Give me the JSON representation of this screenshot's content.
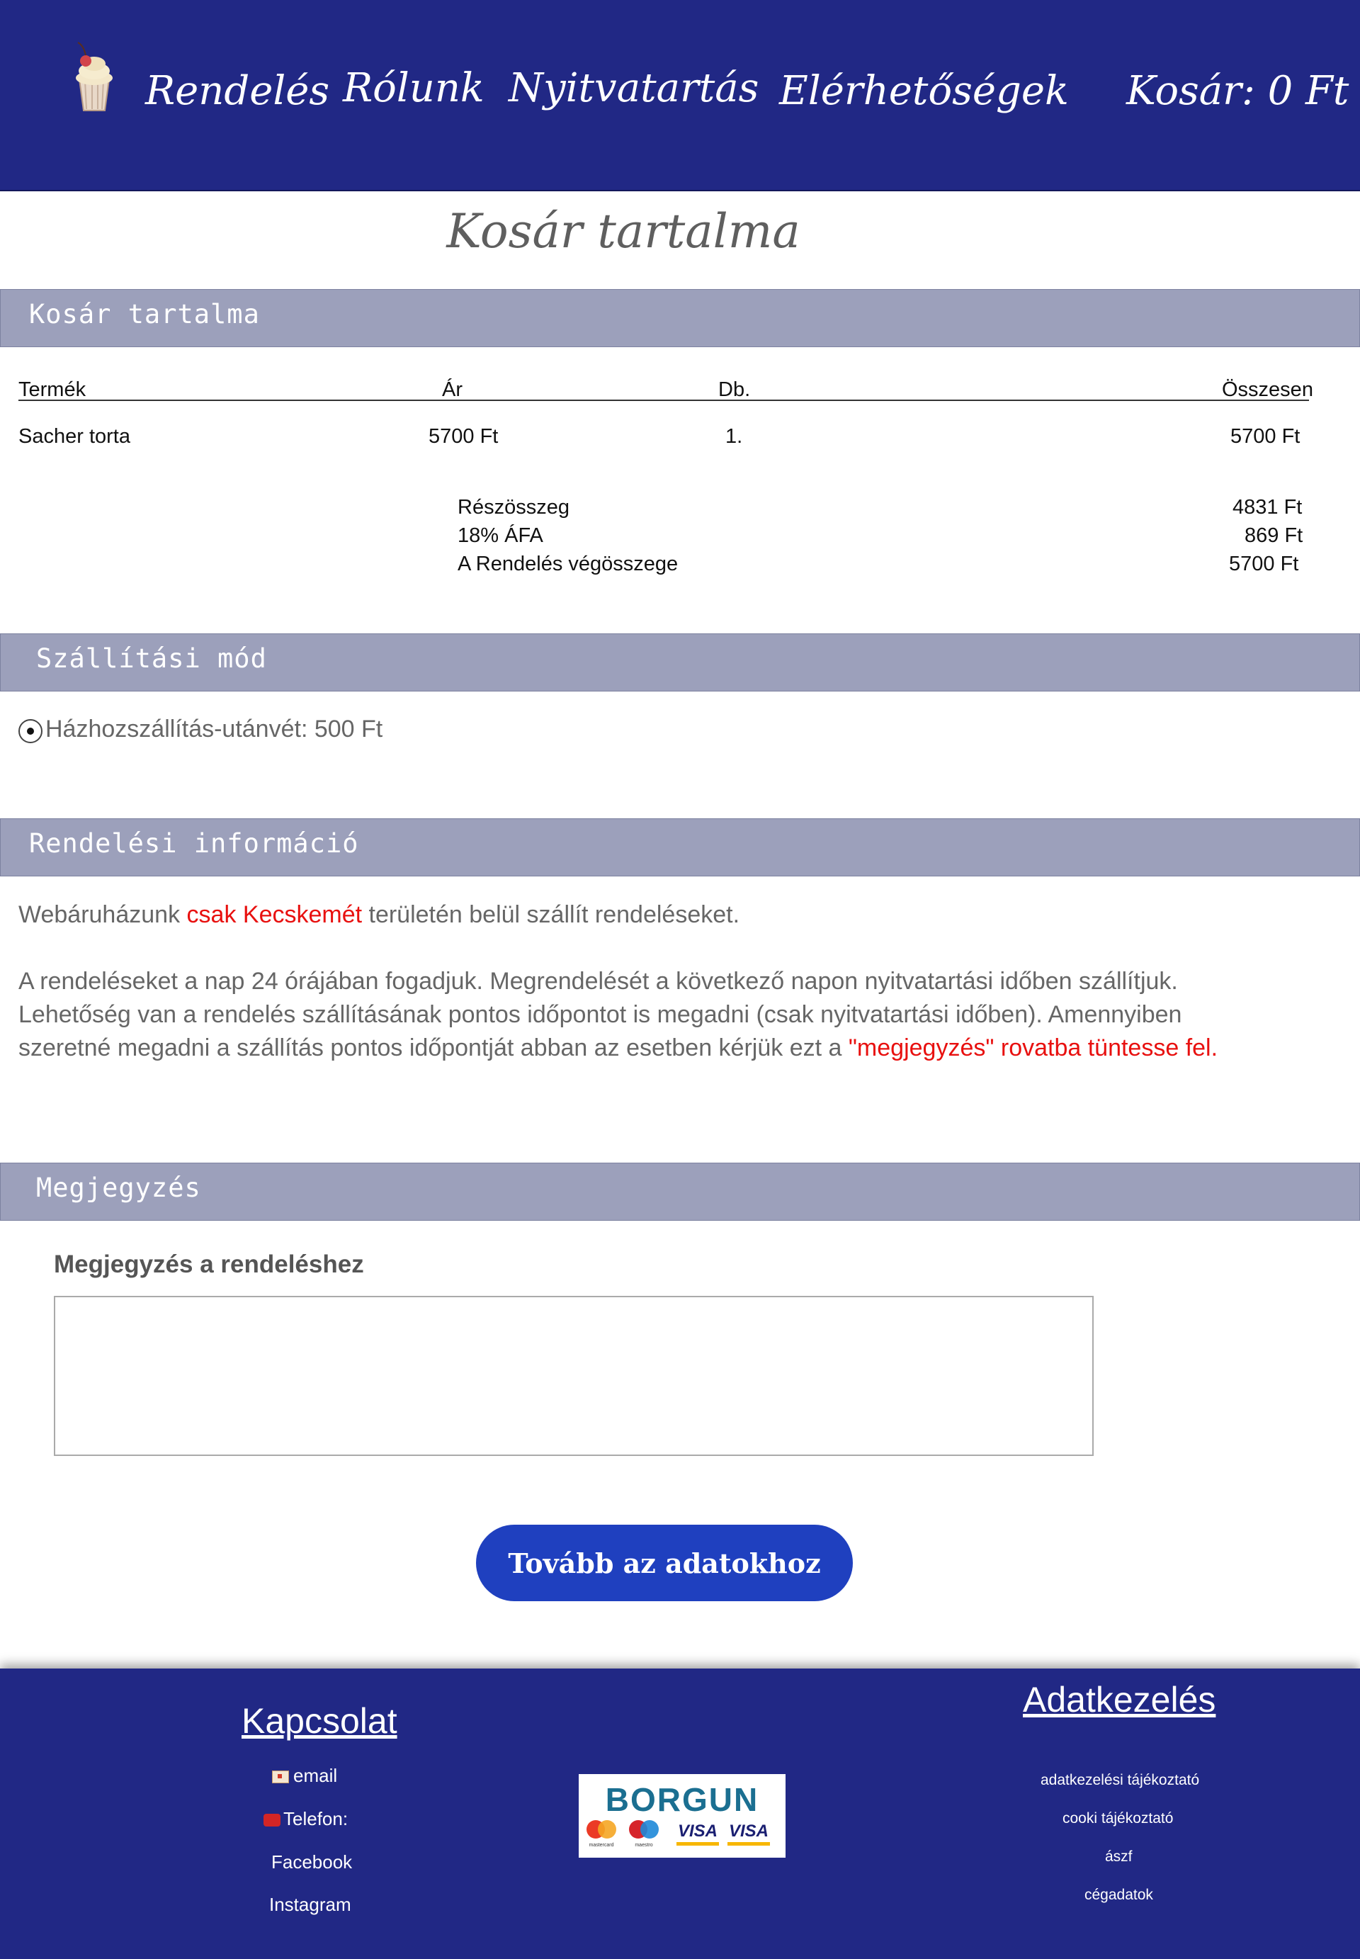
{
  "header": {
    "nav": [
      "Rendelés",
      "Rólunk",
      "Nyitvatartás",
      "Elérhetőségek"
    ],
    "cart": "Kosár: 0 Ft"
  },
  "page_title": "Kosár tartalma",
  "sections": {
    "cart": "Kosár tartalma",
    "shipping": "Szállítási mód",
    "order_info": "Rendelési információ",
    "note": "Megjegyzés"
  },
  "cart_table": {
    "headers": [
      "Termék",
      "Ár",
      "Db.",
      "Összesen"
    ],
    "rows": [
      {
        "product": "Sacher torta",
        "price": "5700 Ft",
        "qty": "1.",
        "total": "5700 Ft"
      }
    ],
    "summary": [
      {
        "label": "Részösszeg",
        "value": "4831 Ft"
      },
      {
        "label": "18% ÁFA",
        "value": "869 Ft"
      },
      {
        "label": "A Rendelés végösszege",
        "value": "5700 Ft"
      }
    ]
  },
  "shipping": {
    "option_label": "Házhozszállítás-utánvét: 500 Ft",
    "selected": true
  },
  "order_info": {
    "line1_a": "Webáruházunk ",
    "line1_red": "csak Kecskemét",
    "line1_b": " területén belül szállít rendeléseket.",
    "line2": "A rendeléseket a nap 24 órájában fogadjuk. Megrendelését a következő napon nyitvatartási időben szállítjuk.",
    "line3": "Lehetőség van a rendelés szállításának pontos időpontot is megadni (csak nyitvatartási időben).  Amennyiben",
    "line4_a": "szeretné megadni a szállítás pontos időpontját abban az esetben kérjük ezt a ",
    "line4_red": "\"megjegyzés\" rovatba tüntesse fel."
  },
  "note": {
    "label": "Megjegyzés a rendeléshez",
    "value": ""
  },
  "cta_label": "Tovább az adatokhoz",
  "footer": {
    "contact_heading": "Kapcsolat",
    "email": "email",
    "phone": "Telefon:",
    "facebook": "Facebook",
    "instagram": "Instagram",
    "privacy_heading": "Adatkezelés",
    "privacy_links": [
      "adatkezelési tájékoztató",
      "cooki tájékoztató",
      "ászf",
      "cégadatok"
    ],
    "payment_logo": {
      "brand": "BORGUN",
      "cards": [
        "mastercard",
        "maestro",
        "VISA",
        "VISA"
      ]
    }
  },
  "colors": {
    "header_bg": "#212885",
    "section_bar": "#9ca0bb",
    "accent_red": "#e8100f",
    "cta_bg": "#1f40bf"
  }
}
